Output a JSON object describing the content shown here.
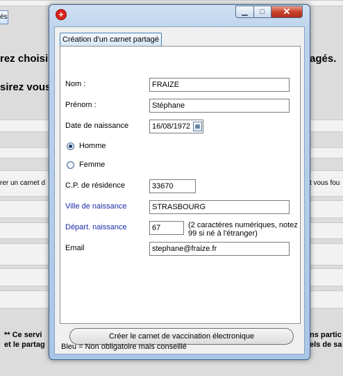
{
  "background": {
    "tab_label": "és",
    "line1": "rez choisi",
    "line1_right": "agés.",
    "line2": "sirez vous",
    "line3_left": "rer un carnet d",
    "line3_right": "t vous fou",
    "footer_left_1": "** Ce servi",
    "footer_left_2": "et le partag",
    "footer_right_1": "ns partic",
    "footer_right_2": "els de sa"
  },
  "window": {
    "app_icon": "red-cross-icon",
    "minimize_glyph": "▁",
    "maximize_glyph": "□",
    "close_glyph": "✕"
  },
  "form": {
    "tab_label": "Création d'un carnet partagé",
    "nom_label": "Nom :",
    "nom_value": "FRAIZE",
    "prenom_label": "Prénom :",
    "prenom_value": "Stéphane",
    "dob_label": "Date de naissance",
    "dob_value": "16/08/1972",
    "gender_options": [
      "Homme",
      "Femme"
    ],
    "gender_selected": "Homme",
    "cp_label": "C.P. de résidence",
    "cp_value": "33670",
    "ville_label": "Ville de naissance",
    "ville_value": "STRASBOURG",
    "depart_label": "Départ. naissance",
    "depart_value": "67",
    "depart_hint": "(2 caractères numériques, notez 99 si né à l'étranger)",
    "email_label": "Email",
    "email_value": "stephane@fraize.fr",
    "create_button": "Créer le carnet de vaccination électronique",
    "legend": "Bleu = Non obligatoire mais conseillé",
    "optional_color": "#1a2aa8"
  }
}
